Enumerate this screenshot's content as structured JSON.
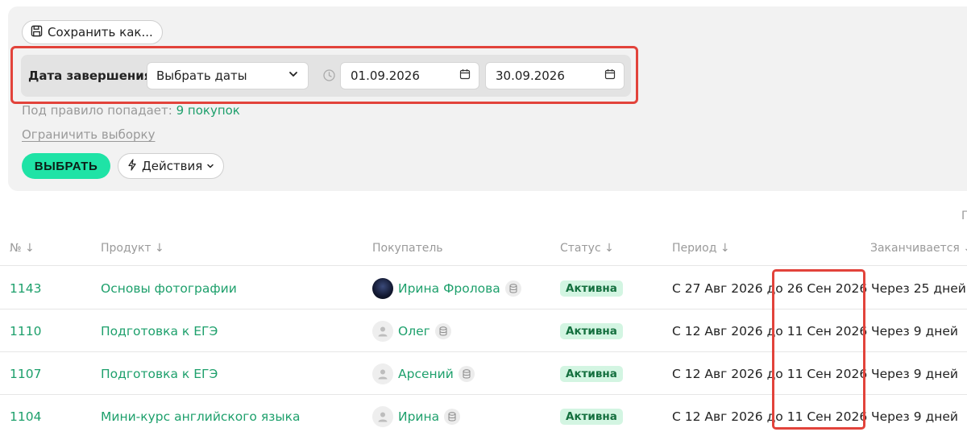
{
  "toolbar": {
    "save_as_label": "Сохранить как..."
  },
  "rule": {
    "label": "Дата завершения",
    "select_value": "Выбрать даты",
    "date_from": "01.09.2026",
    "date_to": "30.09.2026"
  },
  "matches": {
    "prefix": "Под правило попадает:",
    "count": "9 покупок"
  },
  "limit_link": "Ограничить выборку",
  "buttons": {
    "select": "ВЫБРАТЬ",
    "actions": "Действия"
  },
  "cut_label": "П",
  "table": {
    "headers": [
      "№ ↓",
      "Продукт ↓",
      "Покупатель",
      "Статус ↓",
      "Период ↓",
      "Заканчивается ↓"
    ],
    "rows": [
      {
        "num": "1143",
        "product": "Основы фотографии",
        "buyer": "Ирина Фролова",
        "status": "Активна",
        "period": "С 27 Авг 2026 до 26 Сен 2026",
        "ends": "Через 25 дней"
      },
      {
        "num": "1110",
        "product": "Подготовка к ЕГЭ",
        "buyer": "Олег",
        "status": "Активна",
        "period": "С 12 Авг 2026 до 11 Сен 2026",
        "ends": "Через 9 дней"
      },
      {
        "num": "1107",
        "product": "Подготовка к ЕГЭ",
        "buyer": "Арсений",
        "status": "Активна",
        "period": "С 12 Авг 2026 до 11 Сен 2026",
        "ends": "Через 9 дней"
      },
      {
        "num": "1104",
        "product": "Мини-курс английского языка",
        "buyer": "Ирина",
        "status": "Активна",
        "period": "С 12 Авг 2026 до 11 Сен 2026",
        "ends": "Через 9 дней"
      }
    ]
  },
  "colors": {
    "accent": "#1ea06c",
    "primary_button": "#1fe3a6",
    "highlight": "#e2433b",
    "badge_bg": "#d3f5e2"
  }
}
